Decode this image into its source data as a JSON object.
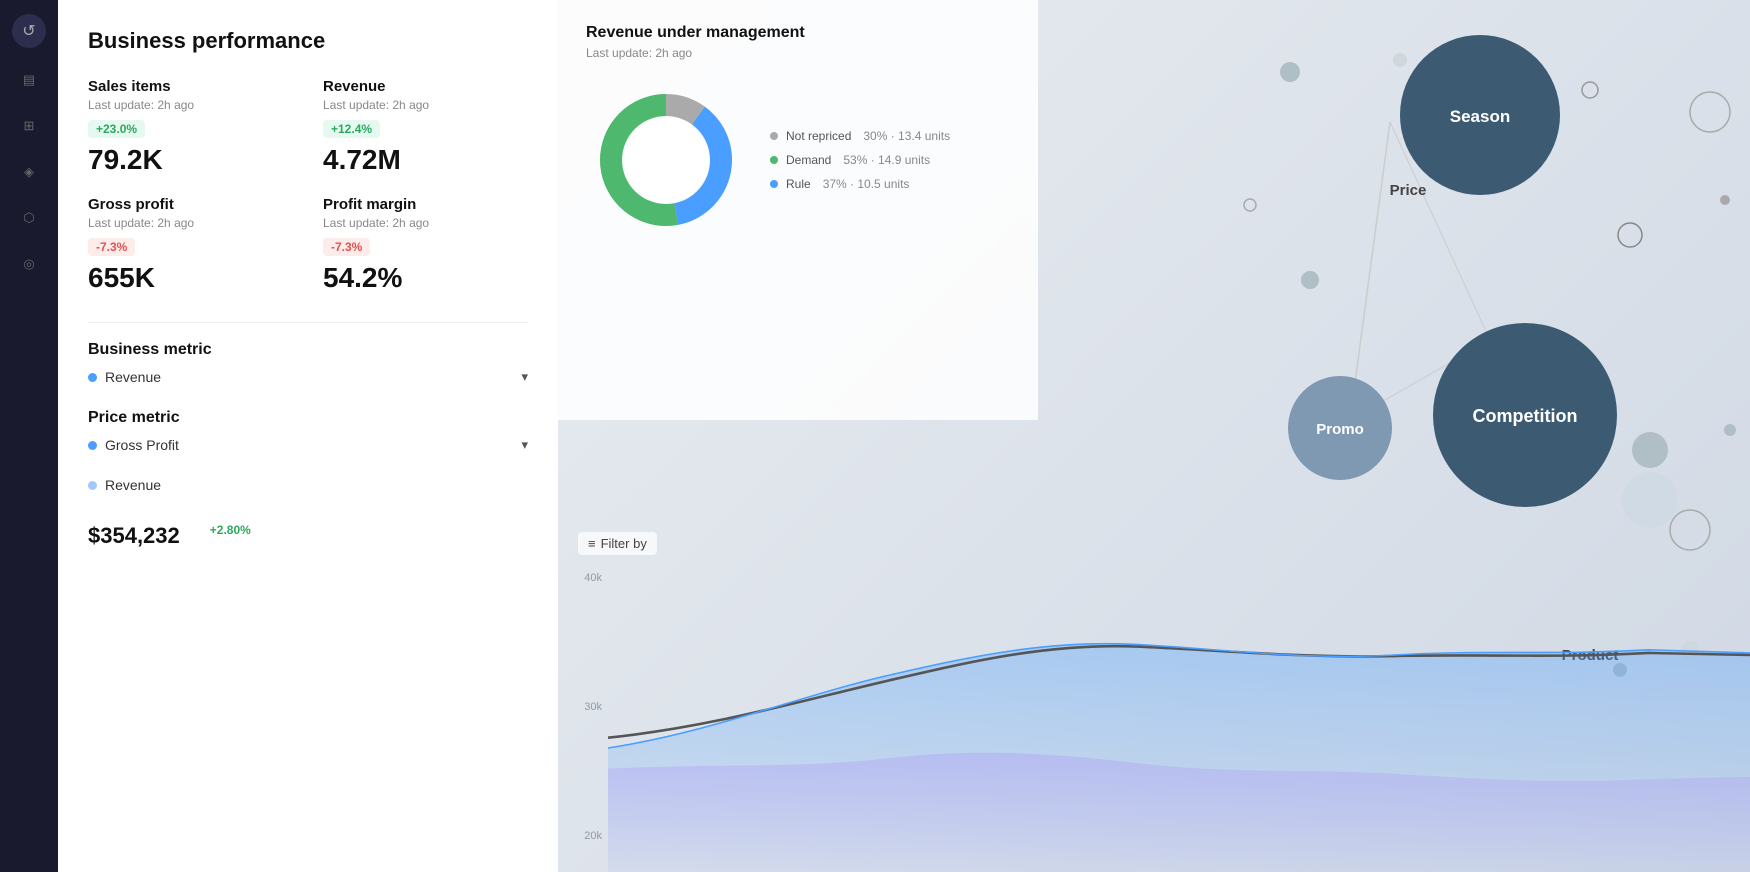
{
  "page": {
    "title": "Business performance"
  },
  "sidebar": {
    "logo_icon": "↺",
    "items": [
      {
        "icon": "▤",
        "label": "menu"
      },
      {
        "icon": "⊞",
        "label": "dashboard"
      },
      {
        "icon": "◈",
        "label": "analytics"
      },
      {
        "icon": "⬡",
        "label": "settings"
      },
      {
        "icon": "◎",
        "label": "profile"
      }
    ]
  },
  "kpis": [
    {
      "id": "sales-items",
      "label": "Sales items",
      "last_update": "Last update: 2h ago",
      "badge": "+23.0%",
      "badge_type": "green",
      "value": "79.2K"
    },
    {
      "id": "revenue",
      "label": "Revenue",
      "last_update": "Last update: 2h ago",
      "badge": "+12.4%",
      "badge_type": "green",
      "value": "4.72M"
    },
    {
      "id": "gross-profit",
      "label": "Gross profit",
      "last_update": "Last update: 2h ago",
      "badge": "-7.3%",
      "badge_type": "red",
      "value": "655K"
    },
    {
      "id": "profit-margin",
      "label": "Profit margin",
      "last_update": "Last update: 2h ago",
      "badge": "-7.3%",
      "badge_type": "red",
      "value": "54.2%"
    }
  ],
  "business_metric": {
    "heading": "Business metric",
    "selected": "Revenue",
    "dot_color": "#4a9eff"
  },
  "price_metric": {
    "heading": "Price metric",
    "selected": "Gross Profit",
    "dot_color": "#4a9eff",
    "sub_item": "Revenue",
    "sub_dot_color": "#a0c8ff"
  },
  "rum": {
    "title": "Revenue under management",
    "last_update": "Last update: 2h ago",
    "legend": [
      {
        "label": "Not repriced",
        "pct": "30%",
        "value": "13.4 units",
        "color": "#aaa"
      },
      {
        "label": "Demand",
        "pct": "53%",
        "value": "14.9 units",
        "color": "#4db86e"
      },
      {
        "label": "Rule",
        "pct": "37%",
        "value": "10.5 units",
        "color": "#4a9eff"
      }
    ],
    "donut": {
      "segments": [
        {
          "color": "#4db86e",
          "pct": 53
        },
        {
          "color": "#4a9eff",
          "pct": 37
        },
        {
          "color": "#aaa",
          "pct": 10
        }
      ]
    }
  },
  "chart": {
    "filter_label": "Filter by",
    "y_labels": [
      "40k",
      "30k",
      "20k"
    ]
  },
  "bubbles": [
    {
      "id": "season",
      "label": "Season",
      "x": 66,
      "y": 14,
      "r": 80,
      "color": "#3d5a73",
      "text_color": "#fff"
    },
    {
      "id": "competition",
      "label": "Competition",
      "x": 78,
      "y": 51,
      "r": 90,
      "color": "#3d5a73",
      "text_color": "#fff"
    },
    {
      "id": "promo",
      "label": "Promo",
      "x": 58,
      "y": 52,
      "r": 50,
      "color": "#8099b3",
      "text_color": "#fff"
    },
    {
      "id": "price",
      "label": "Price",
      "x": 62,
      "y": 23,
      "r": 0,
      "color": "transparent",
      "text_color": "#555"
    },
    {
      "id": "product",
      "label": "Product",
      "x": 79,
      "y": 76,
      "r": 0,
      "color": "transparent",
      "text_color": "#555"
    },
    {
      "id": "small1",
      "label": "",
      "x": 55,
      "y": 10,
      "r": 8,
      "color": "#b0bec5"
    },
    {
      "id": "small2",
      "label": "",
      "x": 72,
      "y": 9,
      "r": 6,
      "color": "#cfd8dc"
    },
    {
      "id": "small3",
      "label": "",
      "x": 90,
      "y": 15,
      "r": 7,
      "color": "transparent",
      "border": "#aaa"
    },
    {
      "id": "small4",
      "label": "",
      "x": 52,
      "y": 30,
      "r": 5,
      "color": "transparent",
      "border": "#aaa"
    },
    {
      "id": "small5",
      "label": "",
      "x": 60,
      "y": 37,
      "r": 8,
      "color": "#b0bec5"
    },
    {
      "id": "small6",
      "label": "",
      "x": 96,
      "y": 32,
      "r": 10,
      "color": "transparent",
      "border": "#888"
    },
    {
      "id": "small7",
      "label": "",
      "x": 70,
      "y": 64,
      "r": 25,
      "color": "#cfd8dc"
    },
    {
      "id": "small8",
      "label": "",
      "x": 95,
      "y": 58,
      "r": 15,
      "color": "#b0bec5"
    },
    {
      "id": "small9",
      "label": "",
      "x": 95,
      "y": 68,
      "r": 18,
      "color": "transparent",
      "border": "#aaa"
    },
    {
      "id": "small10",
      "label": "",
      "x": 86,
      "y": 85,
      "r": 6,
      "color": "#b0bec5"
    },
    {
      "id": "small11",
      "label": "",
      "x": 96,
      "y": 80,
      "r": 8,
      "color": "#cfd8dc"
    }
  ],
  "bottom_stats": [
    {
      "value": "$354,232",
      "change": "",
      "change_type": ""
    },
    {
      "value": "",
      "change": "+2.80%",
      "change_type": "up"
    }
  ]
}
